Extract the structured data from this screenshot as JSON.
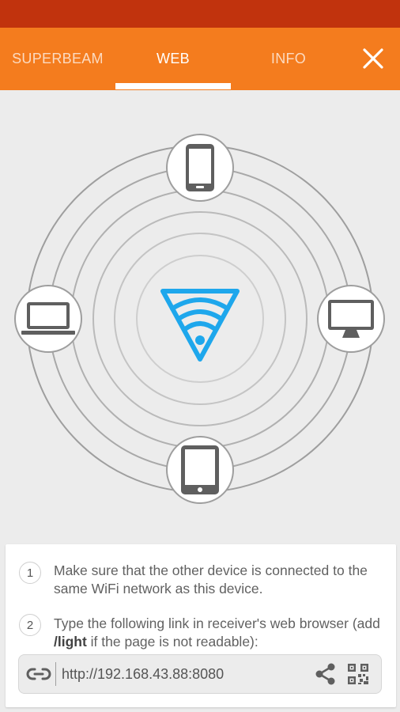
{
  "tabs": [
    {
      "label": "SUPERBEAM",
      "active": false
    },
    {
      "label": "WEB",
      "active": true
    },
    {
      "label": "INFO",
      "active": false
    }
  ],
  "icons": {
    "close": "close-icon",
    "center": "superbeam-wifi-logo",
    "top": "smartphone-icon",
    "left": "laptop-icon",
    "right": "desktop-monitor-icon",
    "bottom": "tablet-icon",
    "link": "link-icon",
    "share": "share-icon",
    "qr": "qr-code-icon"
  },
  "colors": {
    "status_bar": "#c1330d",
    "app_bar": "#f47c1e",
    "logo_blue": "#1ea7ec",
    "background": "#ececec"
  },
  "instructions": {
    "step1": {
      "number": "1",
      "text": "Make sure that the other device is connected to the same WiFi network as this device."
    },
    "step2": {
      "number": "2",
      "text_before": "Type the following link in receiver's web browser (add ",
      "bold": "/light",
      "text_after": " if the page is not readable):"
    }
  },
  "link": {
    "url": "http://192.168.43.88:8080"
  }
}
